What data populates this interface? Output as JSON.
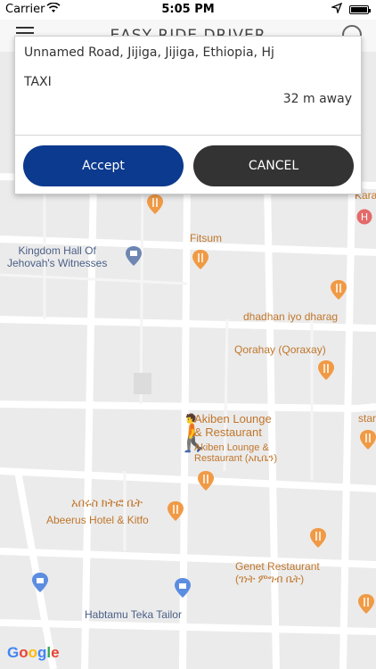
{
  "status_bar": {
    "carrier": "Carrier",
    "time": "5:05 PM"
  },
  "header": {
    "title": "EASY RIDE DRIVER"
  },
  "ride_request": {
    "address": "Unnamed Road, Jijiga, Jijiga, Ethiopia, Hj",
    "service": "TAXI",
    "distance": "32 m away",
    "accept_label": "Accept",
    "cancel_label": "CANCEL"
  },
  "map": {
    "pois": [
      {
        "name": "poi-kara",
        "label": "Kara"
      },
      {
        "name": "poi-kingdom-hall",
        "label": "Kingdom Hall Of\nJehovah's Witnesses"
      },
      {
        "name": "poi-fitsum",
        "label": "Fitsum"
      },
      {
        "name": "poi-dhadhan",
        "label": "dhadhan iyo dharag"
      },
      {
        "name": "poi-qorahay",
        "label": "Qorahay (Qoraxay)"
      },
      {
        "name": "poi-akiben",
        "label": "Akiben Lounge\n& Restaurant"
      },
      {
        "name": "poi-akiben-amh",
        "label": "Akiben Lounge &\nRestaurant (አኪቤን)"
      },
      {
        "name": "poi-star",
        "label": "star"
      },
      {
        "name": "poi-abeerus-amh",
        "label": "አበሩስ ክትፎ ቤት"
      },
      {
        "name": "poi-abeerus",
        "label": "Abeerus Hotel & Kitfo"
      },
      {
        "name": "poi-genet",
        "label": "Genet Restaurant\n(ገነት ምግብ ቤት)"
      },
      {
        "name": "poi-habtamu",
        "label": "Habtamu Teka Tailor"
      }
    ],
    "google_logo": "Google"
  },
  "colors": {
    "accept": "#0b3a8e",
    "cancel": "#333333",
    "poi_orange": "#c0762b",
    "poi_blue": "#4a5f86"
  }
}
